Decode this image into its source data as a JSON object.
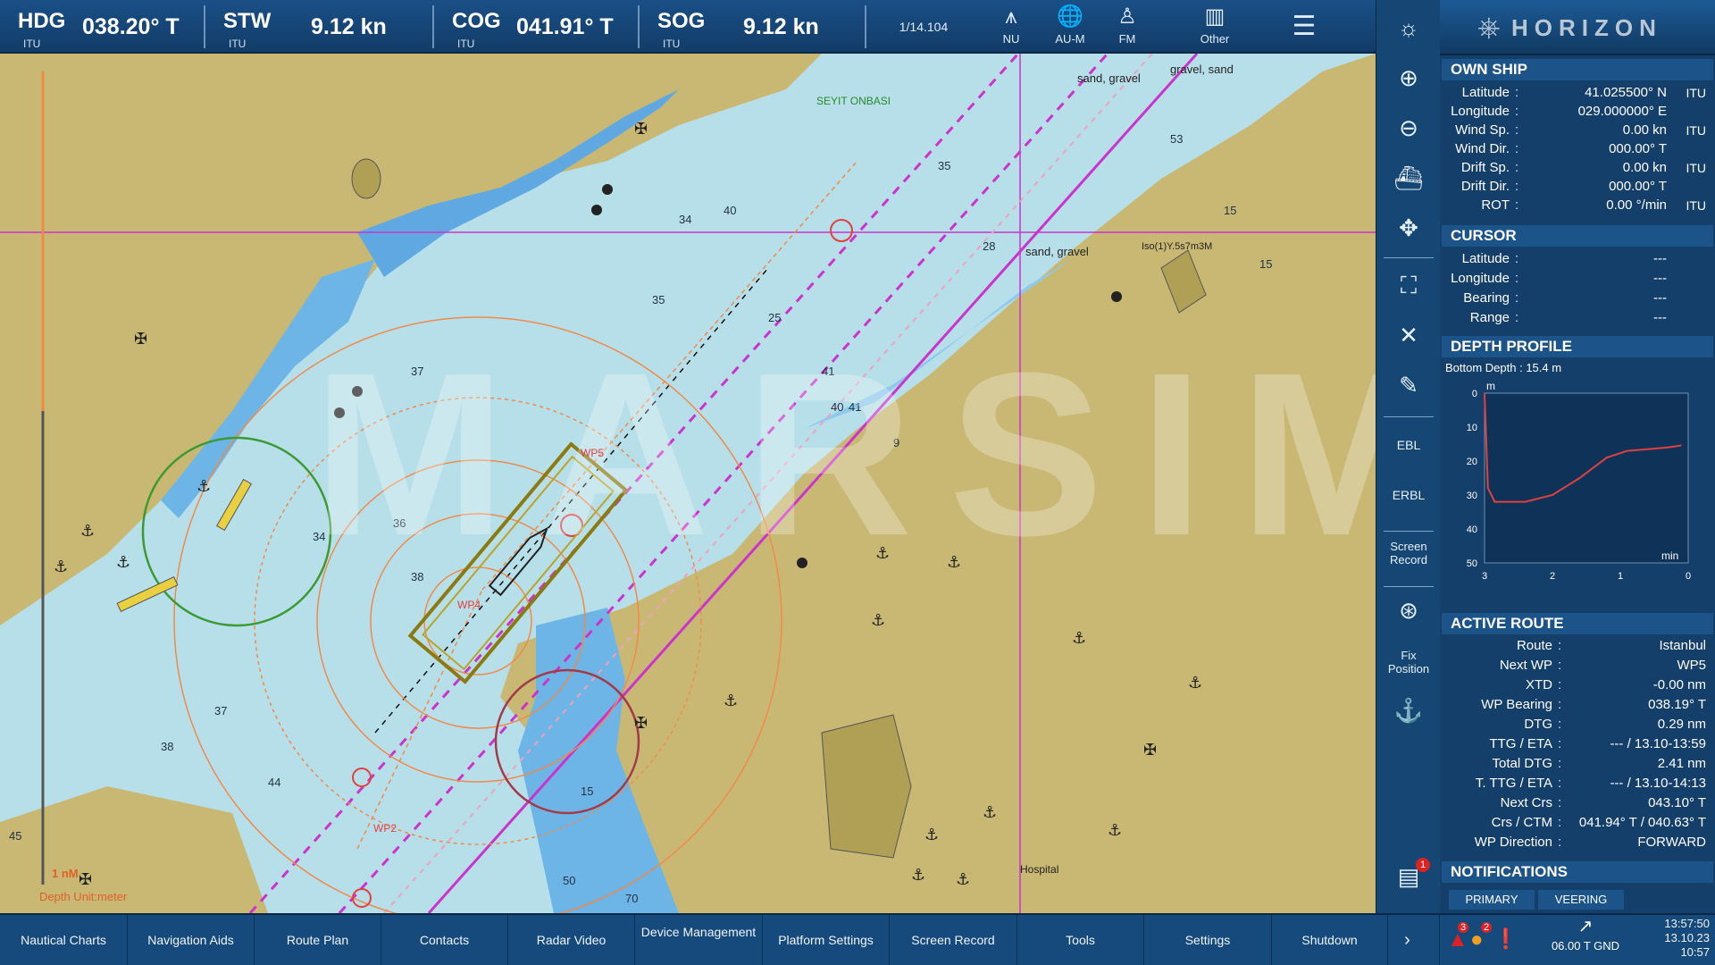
{
  "nav": {
    "hdg": {
      "label": "HDG",
      "value": "038.20° T",
      "source": "ITU"
    },
    "stw": {
      "label": "STW",
      "value": "9.12 kn",
      "source": "ITU"
    },
    "cog": {
      "label": "COG",
      "value": "041.91° T",
      "source": "ITU"
    },
    "sog": {
      "label": "SOG",
      "value": "9.12 kn",
      "source": "ITU"
    }
  },
  "toolbar": {
    "scale": "1/14.104",
    "nu": "NU",
    "aum": "AU-M",
    "fm": "FM",
    "other": "Other"
  },
  "brand": "HORIZON",
  "own_ship": {
    "title": "OWN SHIP",
    "rows": [
      {
        "k": "Latitude",
        "v": "41.025500° N",
        "u": "ITU"
      },
      {
        "k": "Longitude",
        "v": "029.000000° E",
        "u": ""
      },
      {
        "k": "Wind Sp.",
        "v": "0.00 kn",
        "u": "ITU"
      },
      {
        "k": "Wind Dir.",
        "v": "000.00° T",
        "u": ""
      },
      {
        "k": "Drift Sp.",
        "v": "0.00 kn",
        "u": "ITU"
      },
      {
        "k": "Drift Dir.",
        "v": "000.00° T",
        "u": ""
      },
      {
        "k": "ROT",
        "v": "0.00 °/min",
        "u": "ITU"
      }
    ]
  },
  "cursor": {
    "title": "CURSOR",
    "rows": [
      {
        "k": "Latitude",
        "v": "---"
      },
      {
        "k": "Longitude",
        "v": "---"
      },
      {
        "k": "Bearing",
        "v": "---"
      },
      {
        "k": "Range",
        "v": "---"
      }
    ]
  },
  "depth": {
    "title": "DEPTH PROFILE",
    "bottom_depth": "Bottom Depth : 15.4 m",
    "y_unit": "m",
    "x_unit": "min",
    "y_ticks": [
      "0",
      "10",
      "20",
      "30",
      "40",
      "50"
    ],
    "x_ticks": [
      "3",
      "2",
      "1",
      "0"
    ]
  },
  "chart_data": {
    "type": "line",
    "title": "",
    "xlabel": "min",
    "ylabel": "m",
    "x": [
      3,
      2.95,
      2.85,
      2.4,
      2.0,
      1.6,
      1.2,
      0.9,
      0.6,
      0.3,
      0.1
    ],
    "series": [
      {
        "values": [
          0,
          28,
          32,
          32,
          30,
          25,
          19,
          17,
          16.5,
          16,
          15.4
        ]
      }
    ],
    "xlim": [
      3,
      0
    ],
    "ylim": [
      0,
      50
    ],
    "grid": false
  },
  "route": {
    "title": "ACTIVE ROUTE",
    "rows": [
      {
        "k": "Route",
        "v": "Istanbul"
      },
      {
        "k": "Next WP",
        "v": "WP5"
      },
      {
        "k": "XTD",
        "v": "-0.00 nm"
      },
      {
        "k": "WP Bearing",
        "v": "038.19° T"
      },
      {
        "k": "DTG",
        "v": "0.29 nm"
      },
      {
        "k": "TTG / ETA",
        "v": "--- / 13.10-13:59"
      },
      {
        "k": "Total DTG",
        "v": "2.41 nm"
      },
      {
        "k": "T. TTG / ETA",
        "v": "--- / 13.10-14:13"
      },
      {
        "k": "Next Crs",
        "v": "043.10° T"
      },
      {
        "k": "Crs / CTM",
        "v": "041.94° T / 040.63° T"
      },
      {
        "k": "WP Direction",
        "v": "FORWARD"
      }
    ]
  },
  "notifications": {
    "title": "NOTIFICATIONS",
    "tabs": [
      "PRIMARY",
      "VEERING"
    ],
    "badge": "1"
  },
  "rtools": {
    "ebl": "EBL",
    "erbl": "ERBL",
    "screen_record": "Screen Record",
    "fix_position": "Fix Position"
  },
  "bottom_menu": [
    "Nautical Charts",
    "Navigation Aids",
    "Route Plan",
    "Contacts",
    "Radar Video",
    "Device Management",
    "Platform Settings",
    "Screen Record",
    "Tools",
    "Settings",
    "Shutdown"
  ],
  "alarms": {
    "a": "3",
    "b": "2"
  },
  "wind_readout": "06.00 T GND",
  "clock": {
    "time": "13:57:50",
    "date": "13.10.23",
    "ut": "10:57"
  },
  "map_labels": {
    "scale": "1 nM",
    "depth_unit": "Depth Unit:meter",
    "seyit": "SEYIT ONBASI",
    "sand1": "sand, gravel",
    "sand2": "gravel, sand",
    "sand3": "sand, gravel",
    "hospital": "Hospital",
    "light": "Iso(1)Y.5s7m3M",
    "watermark": "MARSIM",
    "wp": [
      "WP5",
      "WP4",
      "WP2"
    ]
  },
  "colors": {
    "land": "#c9b873",
    "shallow": "#5fa8e2",
    "water": "#b7dfe9",
    "route": "#cc33cc",
    "rings": "#f08a4b"
  }
}
